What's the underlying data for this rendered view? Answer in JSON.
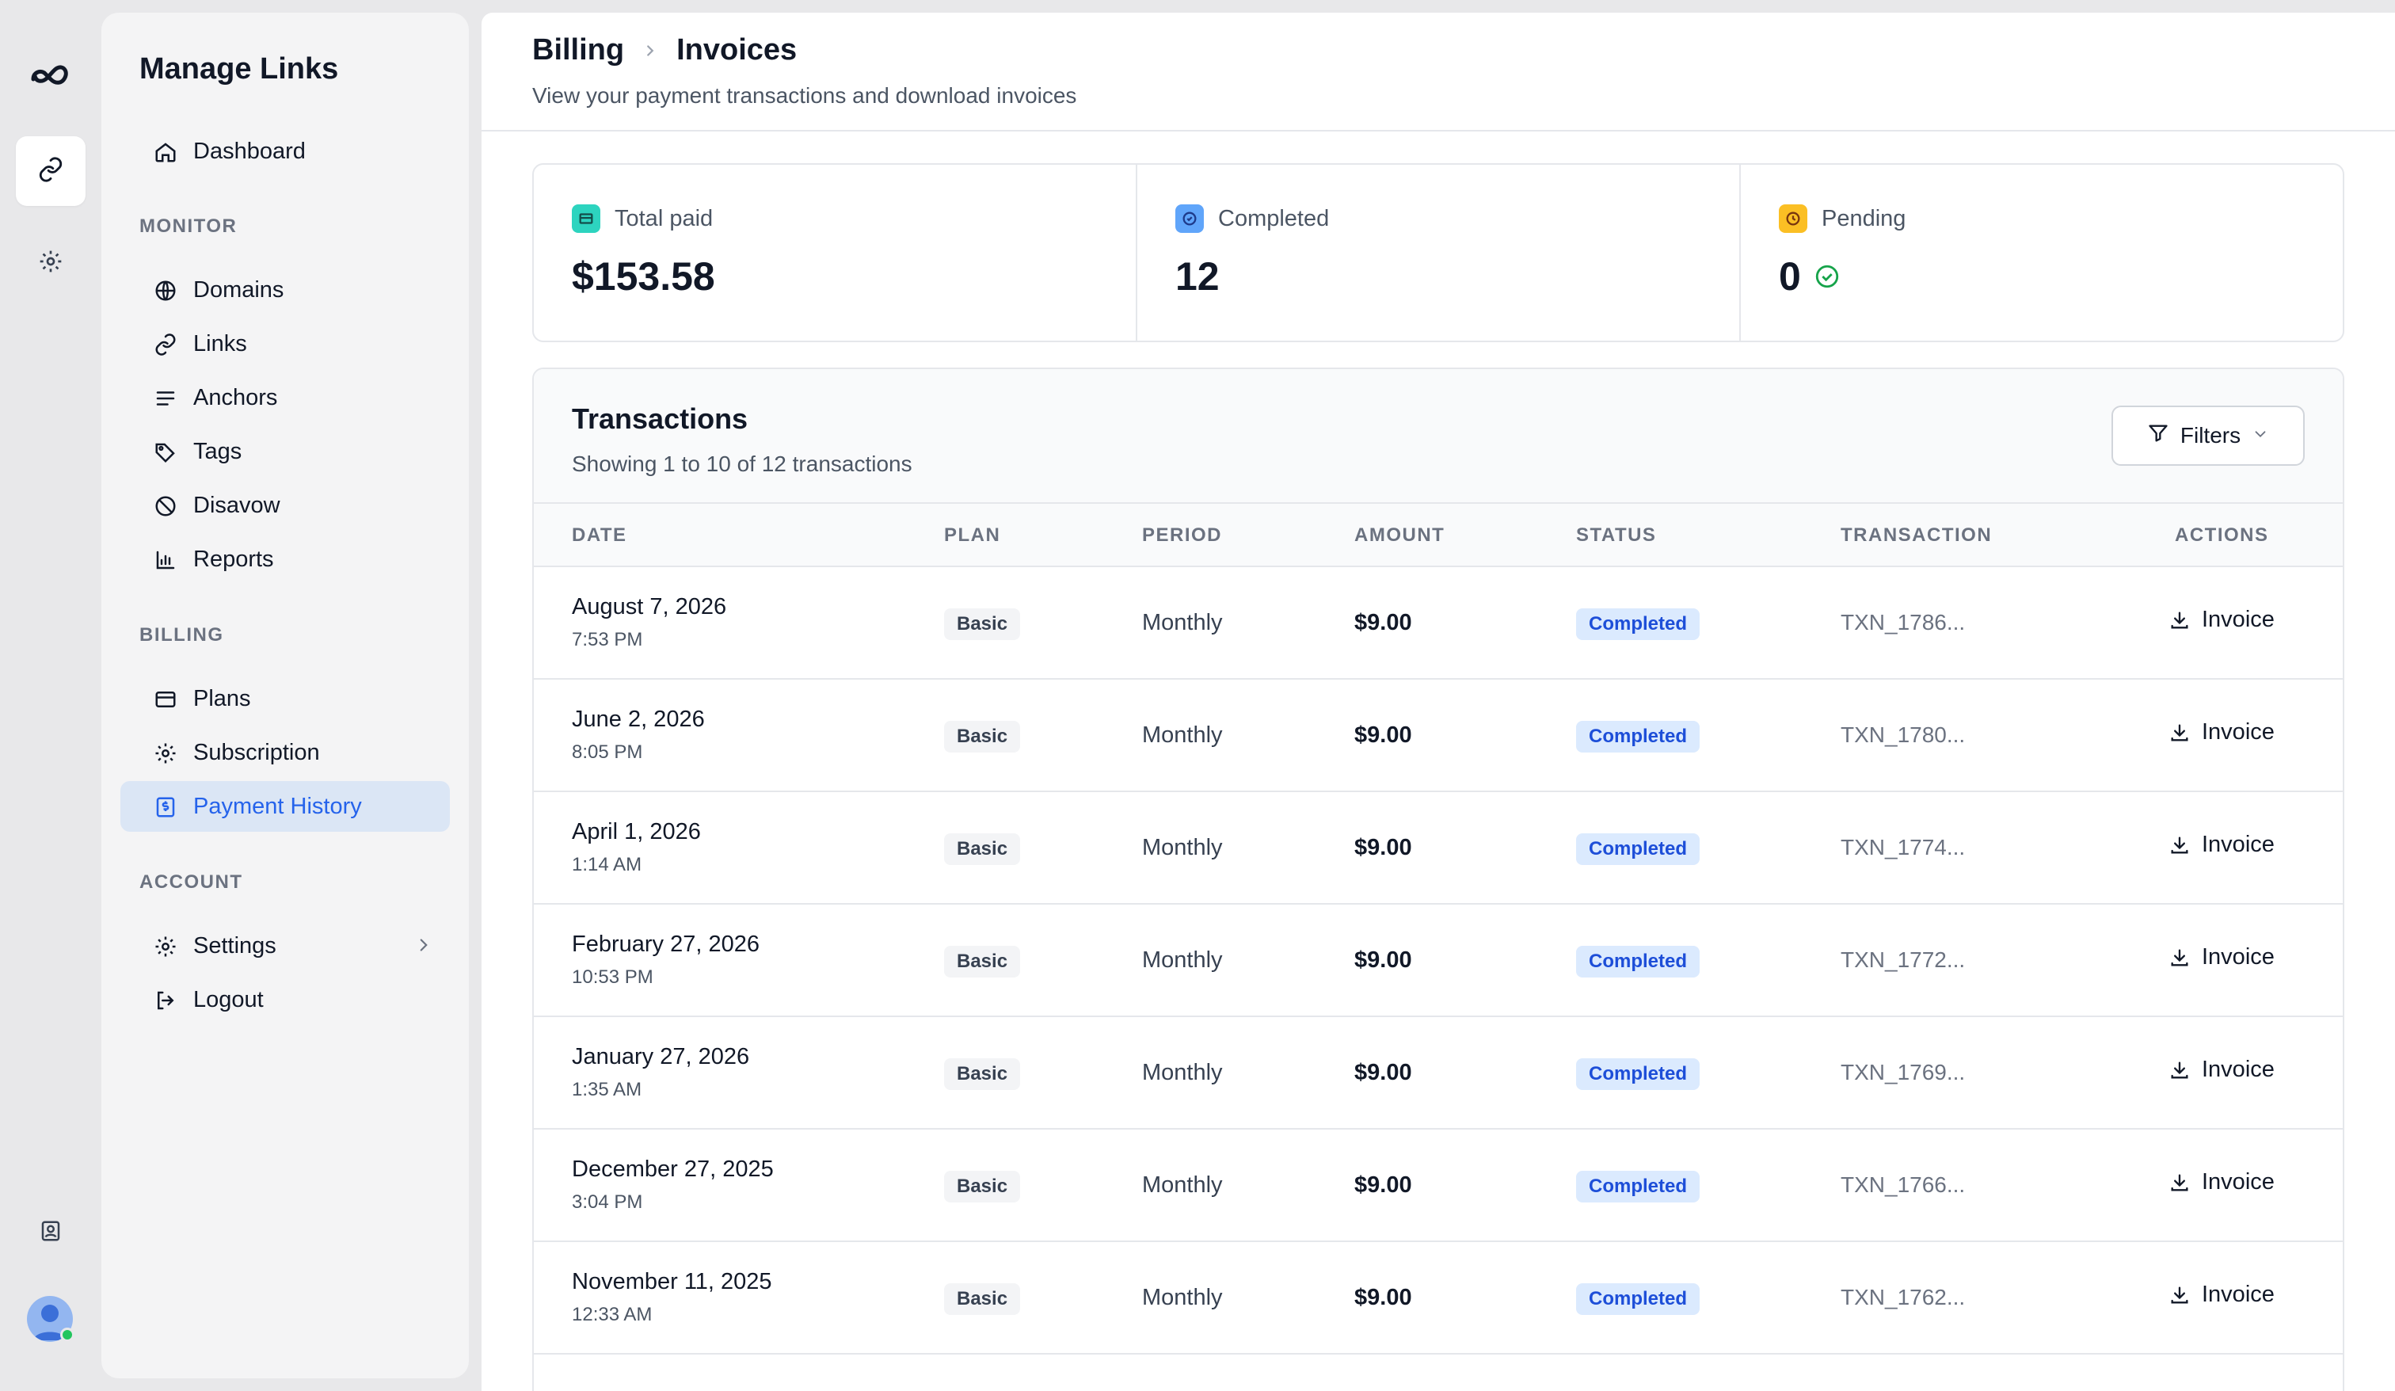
{
  "sidebar": {
    "app_title": "Manage Links",
    "dashboard": "Dashboard",
    "monitor_label": "MONITOR",
    "monitor_items": [
      "Domains",
      "Links",
      "Anchors",
      "Tags",
      "Disavow",
      "Reports"
    ],
    "billing_label": "BILLING",
    "billing_items": [
      "Plans",
      "Subscription",
      "Payment History"
    ],
    "account_label": "ACCOUNT",
    "settings": "Settings",
    "logout": "Logout"
  },
  "header": {
    "crumb_parent": "Billing",
    "crumb_current": "Invoices",
    "subtitle": "View your payment transactions and download invoices"
  },
  "stats": {
    "total_paid_label": "Total paid",
    "total_paid_value": "$153.58",
    "completed_label": "Completed",
    "completed_value": "12",
    "pending_label": "Pending",
    "pending_value": "0"
  },
  "transactions": {
    "title": "Transactions",
    "subtitle": "Showing 1 to 10 of 12 transactions",
    "filters_label": "Filters",
    "columns": [
      "DATE",
      "PLAN",
      "PERIOD",
      "AMOUNT",
      "STATUS",
      "TRANSACTION",
      "ACTIONS"
    ],
    "rows": [
      {
        "date": "August 7, 2026",
        "time": "7:53 PM",
        "plan": "Basic",
        "period": "Monthly",
        "amount": "$9.00",
        "status": "Completed",
        "txn": "TXN_1786...",
        "action": "Invoice"
      },
      {
        "date": "June 2, 2026",
        "time": "8:05 PM",
        "plan": "Basic",
        "period": "Monthly",
        "amount": "$9.00",
        "status": "Completed",
        "txn": "TXN_1780...",
        "action": "Invoice"
      },
      {
        "date": "April 1, 2026",
        "time": "1:14 AM",
        "plan": "Basic",
        "period": "Monthly",
        "amount": "$9.00",
        "status": "Completed",
        "txn": "TXN_1774...",
        "action": "Invoice"
      },
      {
        "date": "February 27, 2026",
        "time": "10:53 PM",
        "plan": "Basic",
        "period": "Monthly",
        "amount": "$9.00",
        "status": "Completed",
        "txn": "TXN_1772...",
        "action": "Invoice"
      },
      {
        "date": "January 27, 2026",
        "time": "1:35 AM",
        "plan": "Basic",
        "period": "Monthly",
        "amount": "$9.00",
        "status": "Completed",
        "txn": "TXN_1769...",
        "action": "Invoice"
      },
      {
        "date": "December 27, 2025",
        "time": "3:04 PM",
        "plan": "Basic",
        "period": "Monthly",
        "amount": "$9.00",
        "status": "Completed",
        "txn": "TXN_1766...",
        "action": "Invoice"
      },
      {
        "date": "November 11, 2025",
        "time": "12:33 AM",
        "plan": "Basic",
        "period": "Monthly",
        "amount": "$9.00",
        "status": "Completed",
        "txn": "TXN_1762...",
        "action": "Invoice"
      }
    ]
  },
  "colors": {
    "accent": "#2563eb",
    "active_nav_bg": "#dbe6f5",
    "status_bg": "#dbeafe",
    "total_paid_icon": "#2dd4bf",
    "completed_icon": "#60a5fa",
    "pending_icon": "#fbbf24",
    "success": "#16a34a"
  }
}
